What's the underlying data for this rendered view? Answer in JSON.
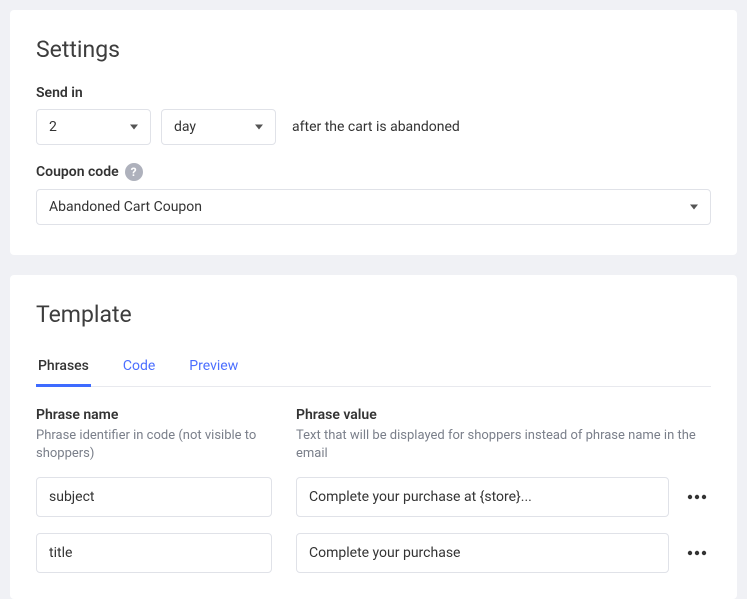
{
  "settings": {
    "title": "Settings",
    "send_in_label": "Send in",
    "send_quantity": "2",
    "send_unit": "day",
    "suffix_text": "after the cart is abandoned",
    "coupon_label": "Coupon code",
    "coupon_value": "Abandoned Cart Coupon"
  },
  "template": {
    "title": "Template",
    "tabs": [
      "Phrases",
      "Code",
      "Preview"
    ],
    "columns": {
      "name_heading": "Phrase name",
      "name_sub": "Phrase identifier in code (not visible to shoppers)",
      "value_heading": "Phrase value",
      "value_sub": "Text that will be displayed for shoppers instead of phrase name in the email"
    },
    "phrases": [
      {
        "name": "subject",
        "value": "Complete your purchase at {store}..."
      },
      {
        "name": "title",
        "value": "Complete your purchase"
      }
    ]
  }
}
